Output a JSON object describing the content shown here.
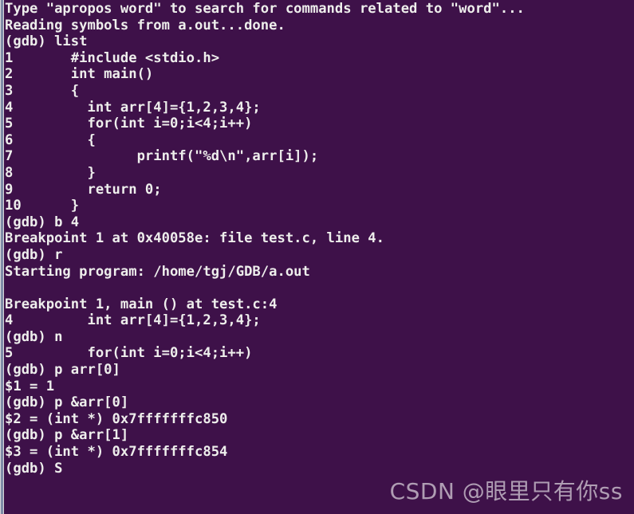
{
  "terminal": {
    "background_color": "#3e1149",
    "foreground_color": "#eeeeec",
    "scrollbar_color": "#7f8ca8",
    "lines": [
      "Type \"apropos word\" to search for commands related to \"word\"...",
      "Reading symbols from a.out...done.",
      "(gdb) list",
      "1       #include <stdio.h>",
      "2       int main()",
      "3       {",
      "4         int arr[4]={1,2,3,4};",
      "5         for(int i=0;i<4;i++)",
      "6         {",
      "7               printf(\"%d\\n\",arr[i]);",
      "8         }",
      "9         return 0;",
      "10      }",
      "(gdb) b 4",
      "Breakpoint 1 at 0x40058e: file test.c, line 4.",
      "(gdb) r",
      "Starting program: /home/tgj/GDB/a.out",
      "",
      "Breakpoint 1, main () at test.c:4",
      "4         int arr[4]={1,2,3,4};",
      "(gdb) n",
      "5         for(int i=0;i<4;i++)",
      "(gdb) p arr[0]",
      "$1 = 1",
      "(gdb) p &arr[0]",
      "$2 = (int *) 0x7fffffffc850",
      "(gdb) p &arr[1]",
      "$3 = (int *) 0x7fffffffc854",
      "(gdb) S"
    ]
  },
  "watermark": {
    "text": "CSDN @眼里只有你ss",
    "color": "#b9a9bd"
  }
}
